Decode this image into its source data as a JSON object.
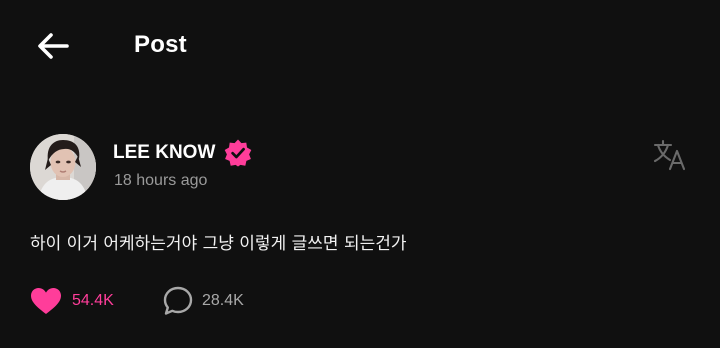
{
  "header": {
    "back_icon": "arrow-left-icon",
    "title": "Post"
  },
  "post": {
    "author": {
      "name": "LEE KNOW",
      "verified_icon": "verified-badge-icon",
      "avatar": "avatar-image"
    },
    "timestamp": "18 hours ago",
    "translate_icon": "translate-icon",
    "body": "하이 이거 어케하는거야 그냥 이렇게 글쓰면 되는건가",
    "likes": {
      "icon": "heart-icon",
      "count": "54.4K"
    },
    "comments": {
      "icon": "comment-bubble-icon",
      "count": "28.4K"
    }
  },
  "colors": {
    "background": "#101010",
    "accent_pink": "#ff3d9a",
    "muted_text": "#9a9a9a"
  }
}
